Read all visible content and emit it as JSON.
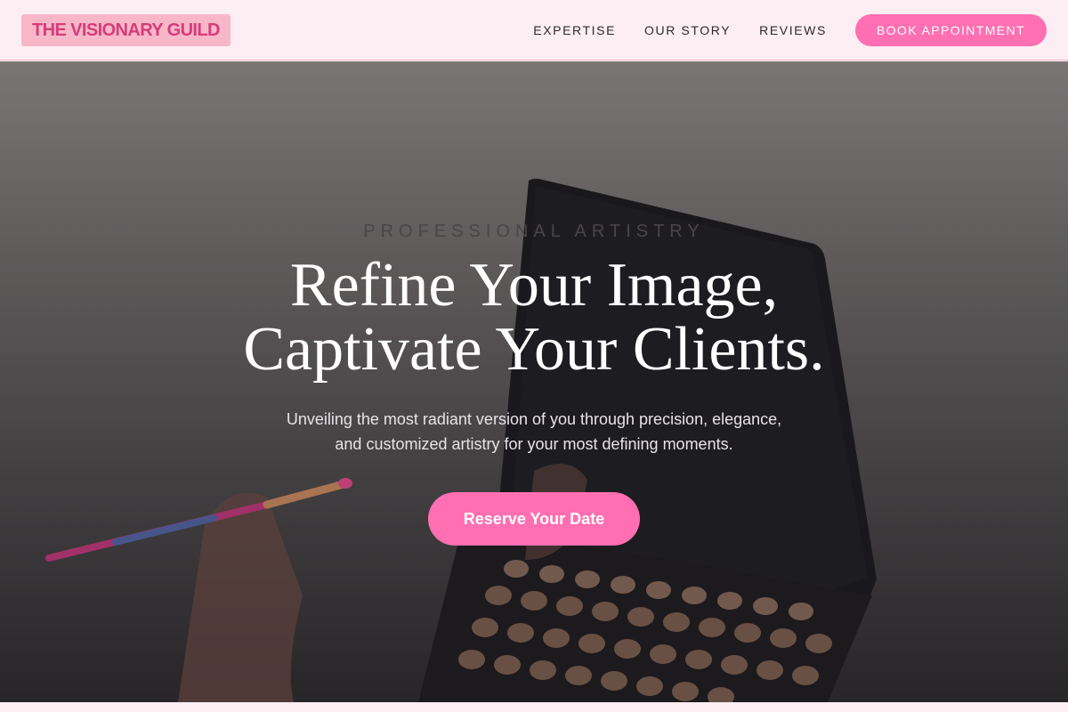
{
  "nav": {
    "logo": "THE VISIONARY GUILD",
    "links": [
      "EXPERTISE",
      "OUR STORY",
      "REVIEWS"
    ],
    "cta": "BOOK APPOINTMENT"
  },
  "hero": {
    "eyebrow": "PROFESSIONAL ARTISTRY",
    "headline_line1": "Refine Your Image,",
    "headline_line2": "Captivate Your Clients.",
    "subtitle_line1": "Unveiling the most radiant version of you through precision, elegance,",
    "subtitle_line2": "and customized artistry for your most defining moments.",
    "cta": "Reserve Your Date"
  },
  "colors": {
    "accent_pink": "#ff6fb1",
    "logo_bg": "#f7b7c9",
    "logo_text": "#d63c7a",
    "nav_bg": "#fdeef3"
  }
}
